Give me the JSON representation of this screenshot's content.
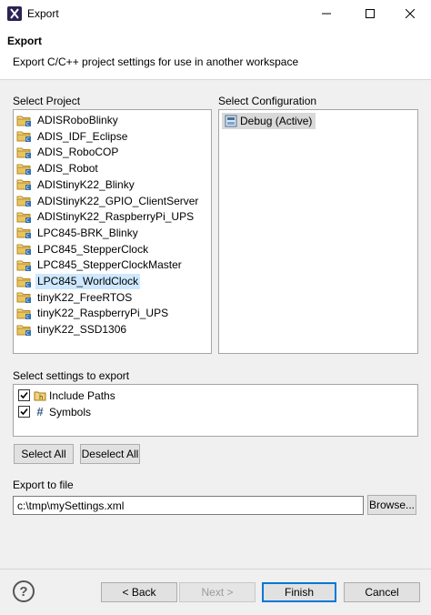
{
  "window": {
    "title": "Export",
    "icon": "eclipse-export-icon"
  },
  "header": {
    "title": "Export",
    "description": "Export C/C++ project settings for use in another workspace"
  },
  "select_project": {
    "label": "Select Project",
    "items": [
      {
        "label": "ADISRoboBlinky",
        "selected": false
      },
      {
        "label": "ADIS_IDF_Eclipse",
        "selected": false
      },
      {
        "label": "ADIS_RoboCOP",
        "selected": false
      },
      {
        "label": "ADIS_Robot",
        "selected": false
      },
      {
        "label": "ADIStinyK22_Blinky",
        "selected": false
      },
      {
        "label": "ADIStinyK22_GPIO_ClientServer",
        "selected": false
      },
      {
        "label": "ADIStinyK22_RaspberryPi_UPS",
        "selected": false
      },
      {
        "label": "LPC845-BRK_Blinky",
        "selected": false
      },
      {
        "label": "LPC845_StepperClock",
        "selected": false
      },
      {
        "label": "LPC845_StepperClockMaster",
        "selected": false
      },
      {
        "label": "LPC845_WorldClock",
        "selected": true
      },
      {
        "label": "tinyK22_FreeRTOS",
        "selected": false
      },
      {
        "label": "tinyK22_RaspberryPi_UPS",
        "selected": false
      },
      {
        "label": "tinyK22_SSD1306",
        "selected": false
      }
    ]
  },
  "select_configuration": {
    "label": "Select Configuration",
    "items": [
      {
        "label": "Debug (Active)",
        "selected": true
      }
    ]
  },
  "settings": {
    "label": "Select settings to export",
    "items": [
      {
        "label": "Include Paths",
        "checked": true,
        "icon": "include-folder-icon"
      },
      {
        "label": "Symbols",
        "checked": true,
        "icon": "hash-icon"
      }
    ],
    "select_all": "Select All",
    "deselect_all": "Deselect All"
  },
  "export_file": {
    "label": "Export to file",
    "value": "c:\\tmp\\mySettings.xml",
    "browse": "Browse..."
  },
  "footer": {
    "help": "?",
    "back": "< Back",
    "next": "Next >",
    "finish": "Finish",
    "cancel": "Cancel"
  },
  "colors": {
    "selection": "#cde8ff",
    "default_button_border": "#0078d7"
  }
}
